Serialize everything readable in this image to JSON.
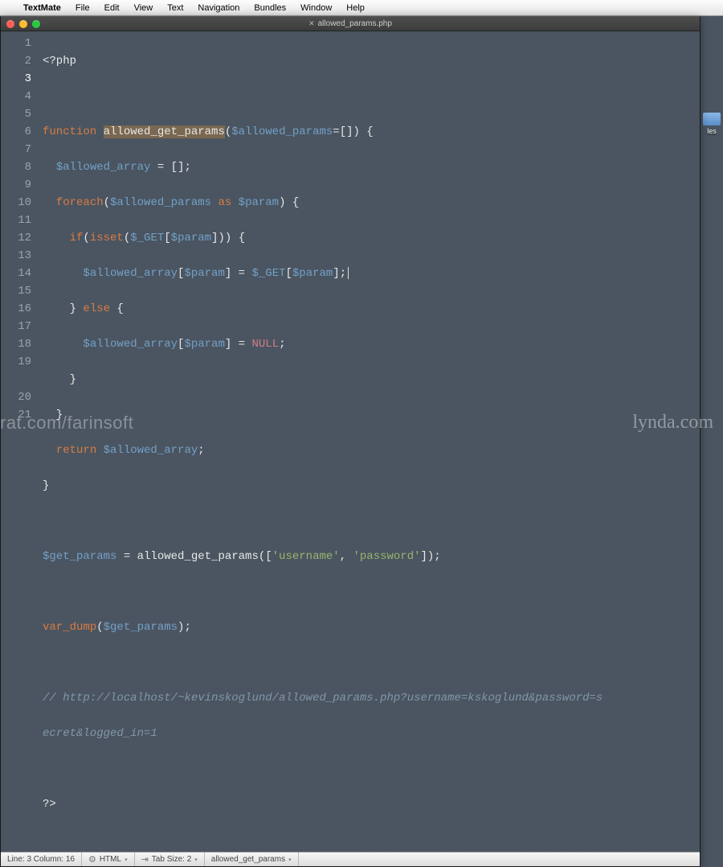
{
  "menubar": {
    "apple": "",
    "app": "TextMate",
    "items": [
      "File",
      "Edit",
      "View",
      "Text",
      "Navigation",
      "Bundles",
      "Window",
      "Help"
    ]
  },
  "window": {
    "tab_label": "allowed_params.php",
    "tab_icon": "✕"
  },
  "desktop": {
    "icon_label": "les"
  },
  "gutter": {
    "lines": [
      "1",
      "2",
      "3",
      "4",
      "5",
      "6",
      "7",
      "8",
      "9",
      "10",
      "11",
      "12",
      "13",
      "14",
      "15",
      "16",
      "17",
      "18",
      "19",
      "",
      "20",
      "21"
    ],
    "highlight_index": 2
  },
  "code": {
    "l1": "<?php",
    "l3_kw": "function ",
    "l3_fn": "allowed_get_params",
    "l3_rest_a": "(",
    "l3_var": "$allowed_params",
    "l3_rest_b": "=[]) {",
    "l4_ind": "  ",
    "l4_var": "$allowed_array",
    "l4_rest": " = [];",
    "l5_ind": "  ",
    "l5_kw": "foreach",
    "l5_a": "(",
    "l5_v1": "$allowed_params",
    "l5_as": " as ",
    "l5_v2": "$param",
    "l5_b": ") {",
    "l6_ind": "    ",
    "l6_kw": "if",
    "l6_a": "(",
    "l6_fn": "isset",
    "l6_b": "(",
    "l6_v1": "$_GET",
    "l6_c": "[",
    "l6_v2": "$param",
    "l6_d": "])) {",
    "l7_ind": "      ",
    "l7_v1": "$allowed_array",
    "l7_a": "[",
    "l7_v2": "$param",
    "l7_b": "] = ",
    "l7_v3": "$_GET",
    "l7_c": "[",
    "l7_v4": "$param",
    "l7_d": "];",
    "l8_ind": "    ",
    "l8_a": "} ",
    "l8_kw": "else",
    "l8_b": " {",
    "l9_ind": "      ",
    "l9_v1": "$allowed_array",
    "l9_a": "[",
    "l9_v2": "$param",
    "l9_b": "] = ",
    "l9_c": "NULL",
    "l9_d": ";",
    "l10": "    }",
    "l11": "  }",
    "l12_ind": "  ",
    "l12_kw": "return ",
    "l12_v": "$allowed_array",
    "l12_b": ";",
    "l13": "}",
    "l15_v": "$get_params",
    "l15_a": " = allowed_get_params([",
    "l15_s1": "'username'",
    "l15_b": ", ",
    "l15_s2": "'password'",
    "l15_c": "]);",
    "l17_fn": "var_dump",
    "l17_a": "(",
    "l17_v": "$get_params",
    "l17_b": ");",
    "l19_a": "// ",
    "l19_b": "http://localhost/~kevinskoglund/allowed_params.php?username=kskoglund&password=s",
    "l19_c": "ecret&logged_in=1",
    "l21": "?>"
  },
  "statusbar": {
    "pos": "Line: 3   Column: 16",
    "lang": "HTML",
    "tab": "Tab Size: 2",
    "symbol": "allowed_get_params"
  },
  "watermarks": {
    "left": "rat.com/farinsoft",
    "right": "lynda.com"
  }
}
